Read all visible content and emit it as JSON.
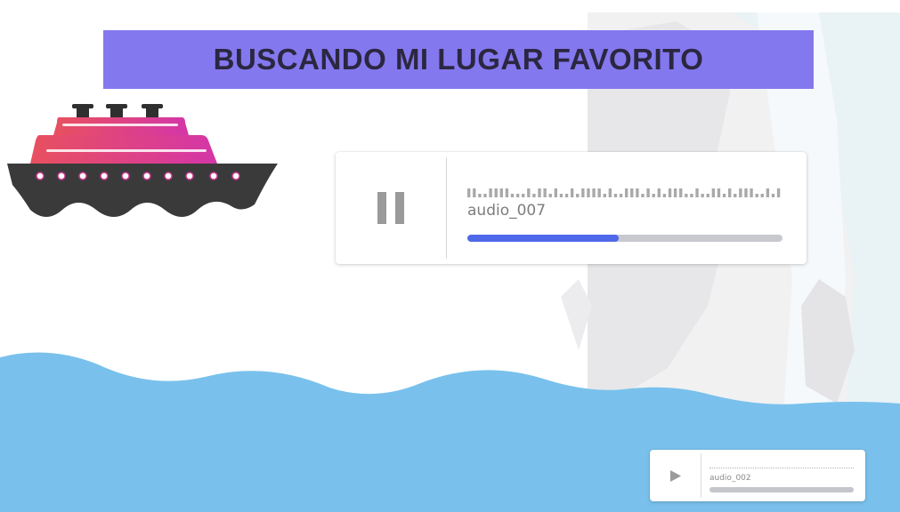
{
  "title": "BUSCANDO MI LUGAR FAVORITO",
  "colors": {
    "banner": "#8478ef",
    "title_text": "#2b2740",
    "water": "#79c1ec",
    "progress_fill": "#4f68ea",
    "progress_track": "#c7c9cf",
    "ship_cabin": "#e0407e",
    "ship_hull": "#3a3a3a"
  },
  "main_player": {
    "audio_name": "audio_007",
    "state": "playing",
    "button_icon": "pause-icon",
    "progress": 0.48
  },
  "small_player": {
    "audio_name": "audio_002",
    "state": "paused",
    "button_icon": "play-icon",
    "progress": 0
  }
}
